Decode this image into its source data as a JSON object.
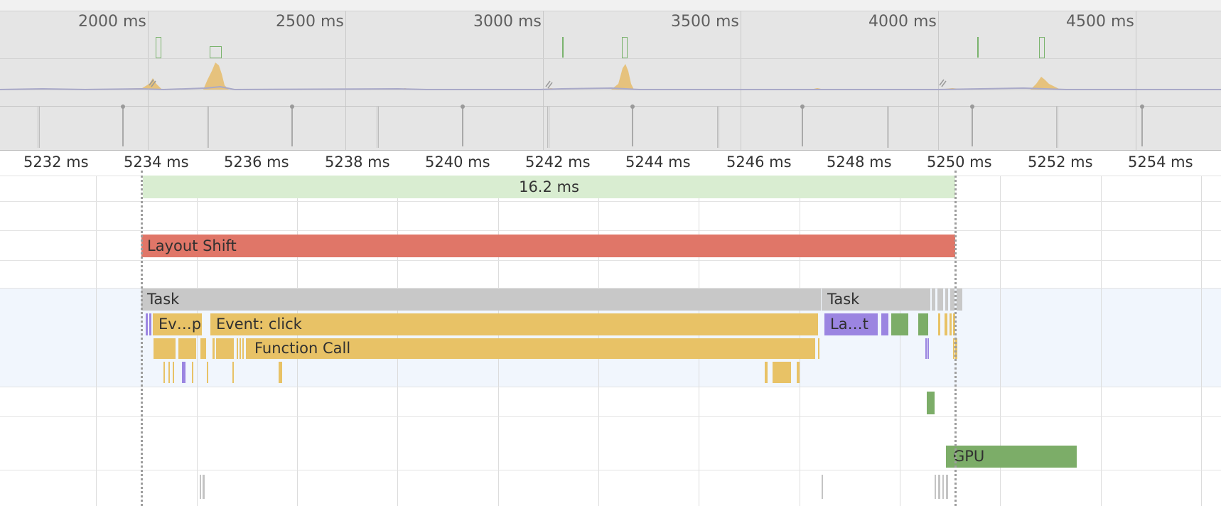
{
  "overview": {
    "time_labels": [
      "2000 ms",
      "2500 ms",
      "3000 ms",
      "3500 ms",
      "4000 ms",
      "4500 ms"
    ]
  },
  "ruler": {
    "labels": [
      "5232 ms",
      "5234 ms",
      "5236 ms",
      "5238 ms",
      "5240 ms",
      "5242 ms",
      "5244 ms",
      "5246 ms",
      "5248 ms",
      "5250 ms",
      "5252 ms",
      "5254 ms"
    ]
  },
  "frames": {
    "frame_duration": "16.2 ms"
  },
  "experience": {
    "layout_shift_label": "Layout Shift"
  },
  "main": {
    "task_1_label": "Task",
    "task_2_label": "Task",
    "event_short_label": "Ev…p",
    "event_click_label": "Event: click",
    "function_call_label": "Function Call",
    "layout_short_label": "La…t"
  },
  "gpu": {
    "label": "GPU"
  },
  "colors": {
    "frame": "#d9edd1",
    "layout_shift": "#e07668",
    "task": "#c8c8c8",
    "scripting": "#e8c266",
    "rendering": "#9b85e1",
    "painting": "#7cad68",
    "main_track_bg": "#f1f6fd"
  }
}
